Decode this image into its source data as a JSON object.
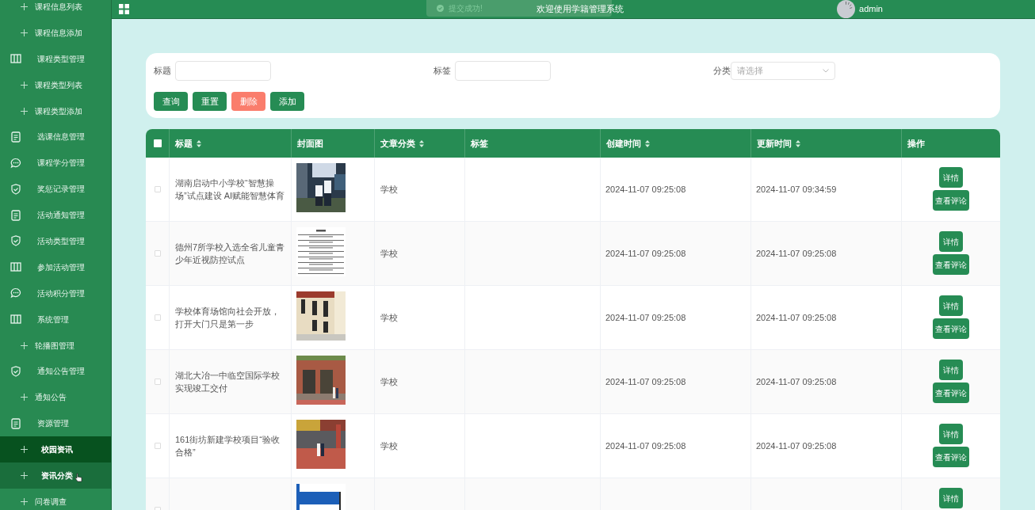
{
  "sidebar": {
    "items": [
      {
        "kind": "sub",
        "label": "课程信息列表",
        "selected": false,
        "hovered": false
      },
      {
        "kind": "sub",
        "label": "课程信息添加",
        "selected": false,
        "hovered": false
      },
      {
        "kind": "columns",
        "label": "课程类型管理",
        "selected": false,
        "hovered": false
      },
      {
        "kind": "sub",
        "label": "课程类型列表",
        "selected": false,
        "hovered": false
      },
      {
        "kind": "sub",
        "label": "课程类型添加",
        "selected": false,
        "hovered": false
      },
      {
        "kind": "document",
        "label": "选课信息管理",
        "selected": false,
        "hovered": false
      },
      {
        "kind": "chat",
        "label": "课程学分管理",
        "selected": false,
        "hovered": false
      },
      {
        "kind": "shield",
        "label": "奖惩记录管理",
        "selected": false,
        "hovered": false
      },
      {
        "kind": "document",
        "label": "活动通知管理",
        "selected": false,
        "hovered": false
      },
      {
        "kind": "shield",
        "label": "活动类型管理",
        "selected": false,
        "hovered": false
      },
      {
        "kind": "columns",
        "label": "参加活动管理",
        "selected": false,
        "hovered": false
      },
      {
        "kind": "chat",
        "label": "活动积分管理",
        "selected": false,
        "hovered": false
      },
      {
        "kind": "columns",
        "label": "系统管理",
        "selected": false,
        "hovered": false
      },
      {
        "kind": "sub",
        "label": "轮播图管理",
        "selected": false,
        "hovered": false
      },
      {
        "kind": "shield",
        "label": "通知公告管理",
        "selected": false,
        "hovered": false
      },
      {
        "kind": "sub",
        "label": "通知公告",
        "selected": false,
        "hovered": false
      },
      {
        "kind": "document",
        "label": "资源管理",
        "selected": false,
        "hovered": false
      },
      {
        "kind": "sub",
        "label": "校园资讯",
        "selected": true,
        "hovered": false
      },
      {
        "kind": "sub",
        "label": "资讯分类",
        "selected": false,
        "hovered": true
      },
      {
        "kind": "sub",
        "label": "问卷调查",
        "selected": false,
        "hovered": false
      }
    ]
  },
  "header": {
    "title": "欢迎使用学籍管理系统",
    "user": "admin"
  },
  "toast": {
    "message": "提交成功!"
  },
  "search": {
    "fields": [
      {
        "kind": "text",
        "label": "标题"
      },
      {
        "kind": "text",
        "label": "标签"
      },
      {
        "kind": "select",
        "label": "分类",
        "placeholder": "请选择"
      }
    ],
    "buttons": [
      {
        "label": "查询",
        "kind": "primary"
      },
      {
        "label": "重置",
        "kind": "primary"
      },
      {
        "label": "删除",
        "kind": "danger"
      },
      {
        "label": "添加",
        "kind": "primary"
      }
    ]
  },
  "table": {
    "select_all": {
      "checked": false
    },
    "columns": [
      {
        "label": "标题",
        "sortable": true
      },
      {
        "label": "封面图",
        "sortable": false
      },
      {
        "label": "文章分类",
        "sortable": true
      },
      {
        "label": "标签",
        "sortable": false
      },
      {
        "label": "创建时间",
        "sortable": true
      },
      {
        "label": "更新时间",
        "sortable": true
      },
      {
        "label": "操作",
        "sortable": false
      }
    ],
    "rows": [
      {
        "title": "湖南启动中小学校“智慧操场”试点建设 AI赋能智慧体育",
        "category": "学校",
        "created": "2024-11-07 09:25:08",
        "updated": "2024-11-07 09:34:59",
        "checked": false,
        "actions": [
          "详情",
          "查看评论"
        ]
      },
      {
        "title": "德州7所学校入选全省儿童青少年近视防控试点",
        "category": "学校",
        "created": "2024-11-07 09:25:08",
        "updated": "2024-11-07 09:25:08",
        "checked": false,
        "actions": [
          "详情",
          "查看评论"
        ]
      },
      {
        "title": "学校体育场馆向社会开放，打开大门只是第一步",
        "category": "学校",
        "created": "2024-11-07 09:25:08",
        "updated": "2024-11-07 09:25:08",
        "checked": false,
        "actions": [
          "详情",
          "查看评论"
        ]
      },
      {
        "title": "湖北大冶一中临空国际学校实现竣工交付",
        "category": "学校",
        "created": "2024-11-07 09:25:08",
        "updated": "2024-11-07 09:25:08",
        "checked": false,
        "actions": [
          "详情",
          "查看评论"
        ]
      },
      {
        "title": "161街坊新建学校项目“验收合格”",
        "category": "学校",
        "created": "2024-11-07 09:25:08",
        "updated": "2024-11-07 09:25:08",
        "checked": false,
        "actions": [
          "详情",
          "查看评论"
        ]
      },
      {
        "checked": false,
        "actions": [
          "详情"
        ]
      }
    ]
  }
}
